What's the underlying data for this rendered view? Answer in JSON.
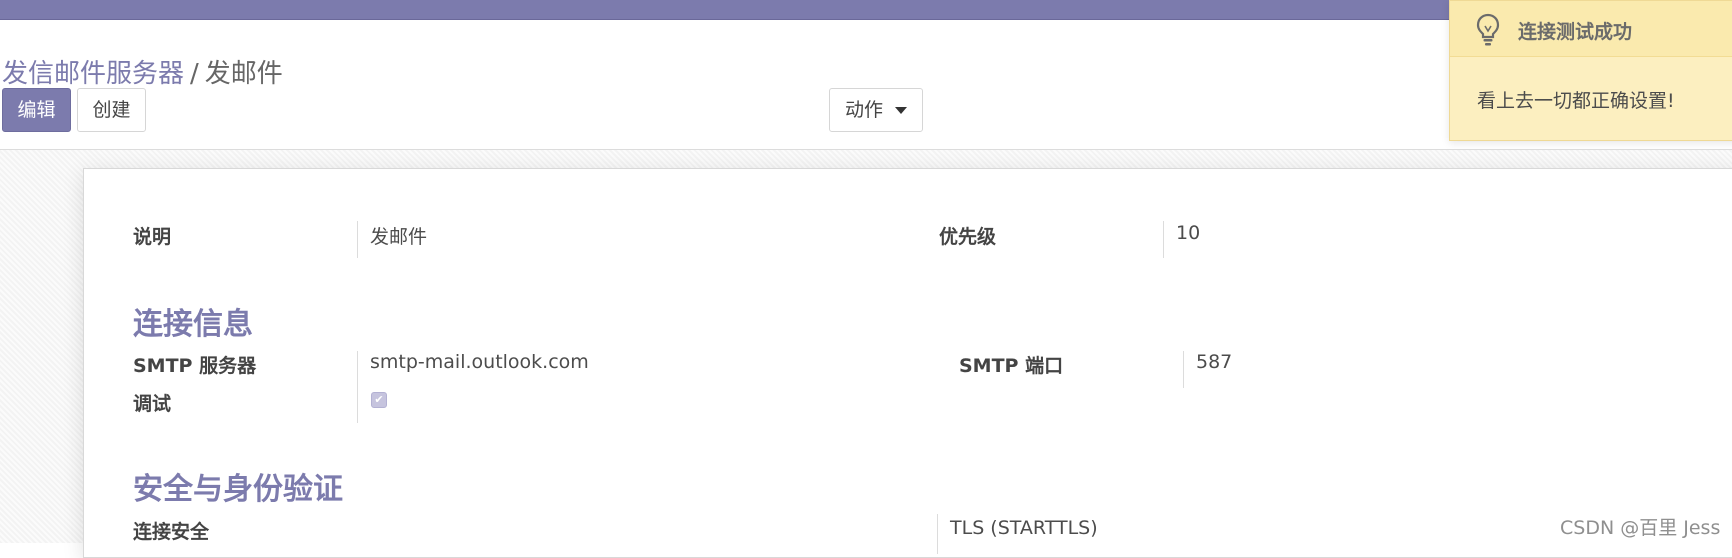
{
  "breadcrumb": {
    "parent": "发信邮件服务器",
    "separator": "/",
    "current": "发邮件"
  },
  "toolbar": {
    "edit_label": "编辑",
    "create_label": "创建",
    "action_label": "动作"
  },
  "form": {
    "description": {
      "label": "说明",
      "value": "发邮件"
    },
    "priority": {
      "label": "优先级",
      "value": "10"
    },
    "connection_section": "连接信息",
    "smtp_server": {
      "label": "SMTP 服务器",
      "value": "smtp-mail.outlook.com"
    },
    "smtp_port": {
      "label": "SMTP 端口",
      "value": "587"
    },
    "debug": {
      "label": "调试",
      "checked": true
    },
    "security_section": "安全与身份验证",
    "connection_security": {
      "label": "连接安全",
      "value": "TLS (STARTTLS)"
    }
  },
  "notification": {
    "title": "连接测试成功",
    "message": "看上去一切都正确设置!",
    "icon": "lightbulb-icon"
  },
  "watermark": "CSDN @百里 Jess",
  "colors": {
    "brand": "#7c7bad",
    "toast_bg": "#fcefc0",
    "toast_header": "#faeaae"
  }
}
